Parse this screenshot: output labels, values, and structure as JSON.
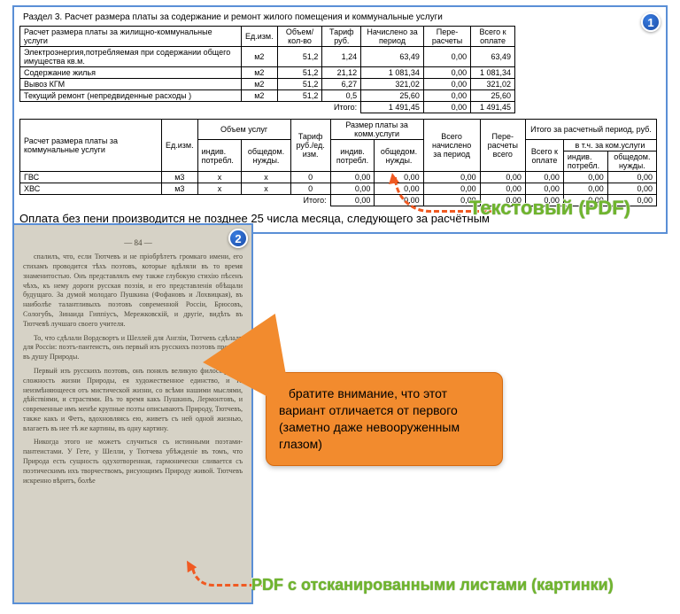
{
  "panel1": {
    "section_title": "Раздел 3. Расчет размера платы за содержание и ремонт жилого помещения и коммунальные услуги",
    "t1": {
      "headers": [
        "Расчет размера платы за жилищно-коммунальные услуги",
        "Ед.изм.",
        "Объем/ кол-во",
        "Тариф руб.",
        "Начислено за период",
        "Пере- расчеты",
        "Всего к оплате"
      ],
      "rows": [
        [
          "Электроэнергия,потребляемая при содержании общего имущества кв.м.",
          "м2",
          "51,2",
          "1,24",
          "63,49",
          "0,00",
          "63,49"
        ],
        [
          "Содержание жилья",
          "м2",
          "51,2",
          "21,12",
          "1 081,34",
          "0,00",
          "1 081,34"
        ],
        [
          "Вывоз КГМ",
          "м2",
          "51,2",
          "6,27",
          "321,02",
          "0,00",
          "321,02"
        ],
        [
          "Текущий ремонт (непредвиденные расходы )",
          "м2",
          "51,2",
          "0,5",
          "25,60",
          "0,00",
          "25,60"
        ]
      ],
      "total_label": "Итого:",
      "total_values": [
        "1 491,45",
        "0,00",
        "1 491,45"
      ]
    },
    "t2": {
      "h_service": "Расчет размера платы за коммунальные услуги",
      "h_ed": "Ед.изм.",
      "h_vol": "Объем услуг",
      "h_tarif": "Тариф руб./ед. изм.",
      "h_razmer": "Размер платы за комм.услуги",
      "h_vsego_nach": "Всего начислено за период",
      "h_pere": "Пере- расчеты всего",
      "h_itogo": "Итого за расчетный период, руб.",
      "h_indiv": "индив. потребл.",
      "h_obsh": "общедом. нужды.",
      "h_vsego_opl": "Всего к оплате",
      "h_vtch": "в т.ч. за ком.услуги",
      "rows": [
        [
          "ГВС",
          "м3",
          "x",
          "x",
          "0",
          "0,00",
          "0,00",
          "0,00",
          "0,00",
          "0,00",
          "0,00",
          "0,00"
        ],
        [
          "ХВС",
          "м3",
          "x",
          "x",
          "0",
          "0,00",
          "0,00",
          "0,00",
          "0,00",
          "0,00",
          "0,00",
          "0,00"
        ]
      ],
      "total_label": "Итого:",
      "total_values": [
        "0,00",
        "0,00",
        "0,00",
        "0,00",
        "0,00",
        "0,00",
        "0,00"
      ]
    },
    "payline": "Оплата без пени производится не позднее 25 числа месяца, следующего за расчётным"
  },
  "badges": {
    "one": "1",
    "two": "2"
  },
  "labels": {
    "text_pdf": "Текстовый (PDF)",
    "scan_pdf": "PDF с отсканированными листами (картинки)"
  },
  "callout": "Обратите внимание, что этот вариант отличается от первого (заметно даже невооруженным глазом)",
  "scan": {
    "pagenum": "— 84 —",
    "p1": "спалилъ, что, если Тютчевъ и не прiобрѣтетъ громкаго имени, его стихамъ проводится тѣхъ поэтовъ, которые вдѣляли въ то время знаменитостью. Онъ представлялъ ему также глубокую стихiю пѣсенъ чѣхъ, къ нему дороги русская поэзiя, и его представленiя обѣщали будущаго. За думой молодаго Пушкина (Фофановъ и Лохвицкая), въ наиболѣе талантливыхъ поэтовъ современной Россiи, Брюсовъ, Сологубъ, Зинаида Гиппiусъ, Мережковскiй, и другiе, видѣть въ Тютчевѣ лучшаго своего учителя.",
    "p2": "То, что сдѣлали Вордсвортъ и Шеллей для Англiи, Тютчевъ сдѣлалъ для Россiи: поэтъ-пантеистъ, онъ первый изъ русскихъ поэтовъ проникъ въ душу Природы.",
    "p3": "Первый изъ русскихъ поэтовъ, онъ понялъ великую философскую сложность жизни Природы, ея художественное единство, и то неизмѣняющееся отъ мистической жизни, со всѣми нашими мыслями, дѣйствiями, и страстями. Въ то время какъ Пушкинъ, Лермонтовъ, и современные имъ менѣе крупные поэты описываютъ Природу, Тютчевъ, также какъ и Фетъ, вдохновляясь ею, живетъ съ ней одной жизнью, влагаетъ въ нее тѣ же картины, въ одну картину.",
    "p4": "Никогда этого не можетъ случиться съ истинными поэтами-пантеистами. У Гете, у Шелли, у Тютчева убѣжденiе въ томъ, что Природа есть сущность одухотворенная, гармонически сливается съ поэтическимъ ихъ творчествомъ, рисующимъ Природу живой. Тютчевъ искренно вѣритъ, болѣе"
  }
}
